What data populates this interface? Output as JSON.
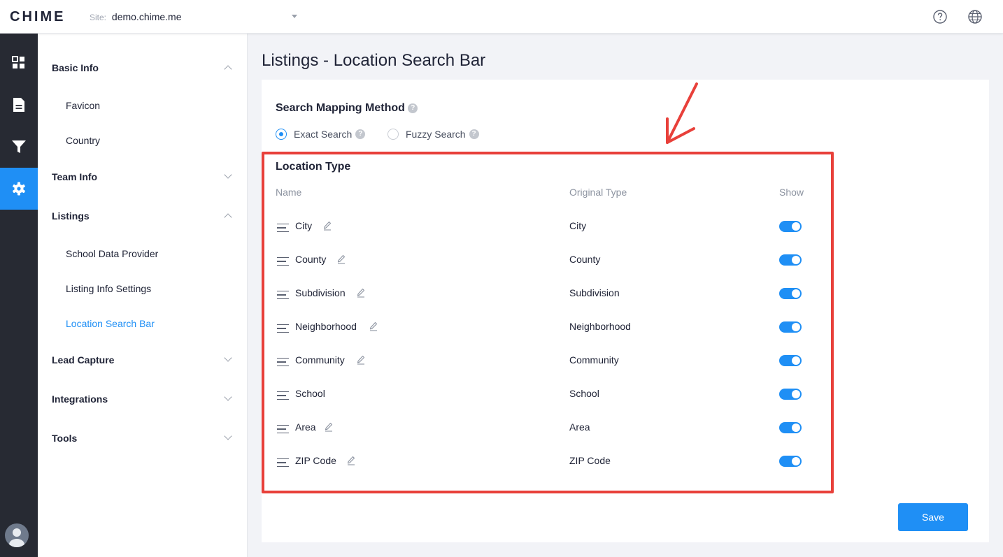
{
  "header": {
    "logo": "CHIME",
    "site_label": "Site:",
    "site_value": "demo.chime.me"
  },
  "sidebar": {
    "sections": [
      {
        "label": "Basic Info",
        "expanded": true,
        "items": [
          "Favicon",
          "Country"
        ]
      },
      {
        "label": "Team Info",
        "expanded": false,
        "items": []
      },
      {
        "label": "Listings",
        "expanded": true,
        "items": [
          "School Data Provider",
          "Listing Info Settings",
          "Location Search Bar"
        ]
      },
      {
        "label": "Lead Capture",
        "expanded": false,
        "items": []
      },
      {
        "label": "Integrations",
        "expanded": false,
        "items": []
      },
      {
        "label": "Tools",
        "expanded": false,
        "items": []
      }
    ],
    "active_item": "Location Search Bar"
  },
  "main": {
    "title": "Listings - Location Search Bar",
    "search_mapping": {
      "title": "Search Mapping Method",
      "options": [
        "Exact Search",
        "Fuzzy Search"
      ],
      "selected": "Exact Search"
    },
    "location_type": {
      "title": "Location Type",
      "columns": [
        "Name",
        "Original Type",
        "Show"
      ],
      "rows": [
        {
          "name": "City",
          "original": "City",
          "editable": true,
          "show": true
        },
        {
          "name": "County",
          "original": "County",
          "editable": true,
          "show": true
        },
        {
          "name": "Subdivision",
          "original": "Subdivision",
          "editable": true,
          "show": true
        },
        {
          "name": "Neighborhood",
          "original": "Neighborhood",
          "editable": true,
          "show": true
        },
        {
          "name": "Community",
          "original": "Community",
          "editable": true,
          "show": true
        },
        {
          "name": "School",
          "original": "School",
          "editable": false,
          "show": true
        },
        {
          "name": "Area",
          "original": "Area",
          "editable": true,
          "show": true
        },
        {
          "name": "ZIP Code",
          "original": "ZIP Code",
          "editable": true,
          "show": true
        }
      ]
    },
    "save_label": "Save"
  },
  "colors": {
    "accent": "#1f8ff5",
    "rail": "#272a33",
    "highlight": "#e8403a"
  },
  "icons": {
    "rail": [
      "dashboard-icon",
      "document-icon",
      "filter-icon",
      "gear-icon"
    ],
    "top": [
      "help-icon",
      "globe-icon"
    ]
  }
}
